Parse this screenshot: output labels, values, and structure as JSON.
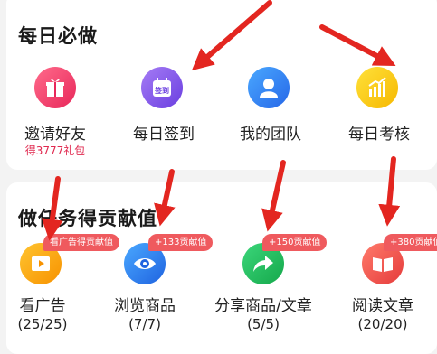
{
  "daily": {
    "title": "每日必做",
    "items": [
      {
        "label": "邀请好友",
        "sub": "得3777礼包",
        "icon": "gift-icon"
      },
      {
        "label": "每日签到",
        "icon": "calendar-signin-icon"
      },
      {
        "label": "我的团队",
        "icon": "team-icon"
      },
      {
        "label": "每日考核",
        "icon": "bar-chart-icon"
      }
    ]
  },
  "tasks": {
    "title": "做任务得贡献值",
    "items": [
      {
        "label": "看广告",
        "count": "(25/25)",
        "badge": "看广告得贡献值",
        "icon": "video-icon"
      },
      {
        "label": "浏览商品",
        "count": "(7/7)",
        "badge": "+133贡献值",
        "icon": "eye-icon"
      },
      {
        "label": "分享商品/文章",
        "count": "(5/5)",
        "badge": "+150贡献值",
        "icon": "share-icon"
      },
      {
        "label": "阅读文章",
        "count": "(20/20)",
        "badge": "+380贡献值",
        "icon": "book-icon"
      }
    ]
  },
  "calendar_text": "签到",
  "colors": {
    "accent_red": "#ef5a5e",
    "arrow_red": "#e32620",
    "sub_text_red": "#e0294f"
  }
}
